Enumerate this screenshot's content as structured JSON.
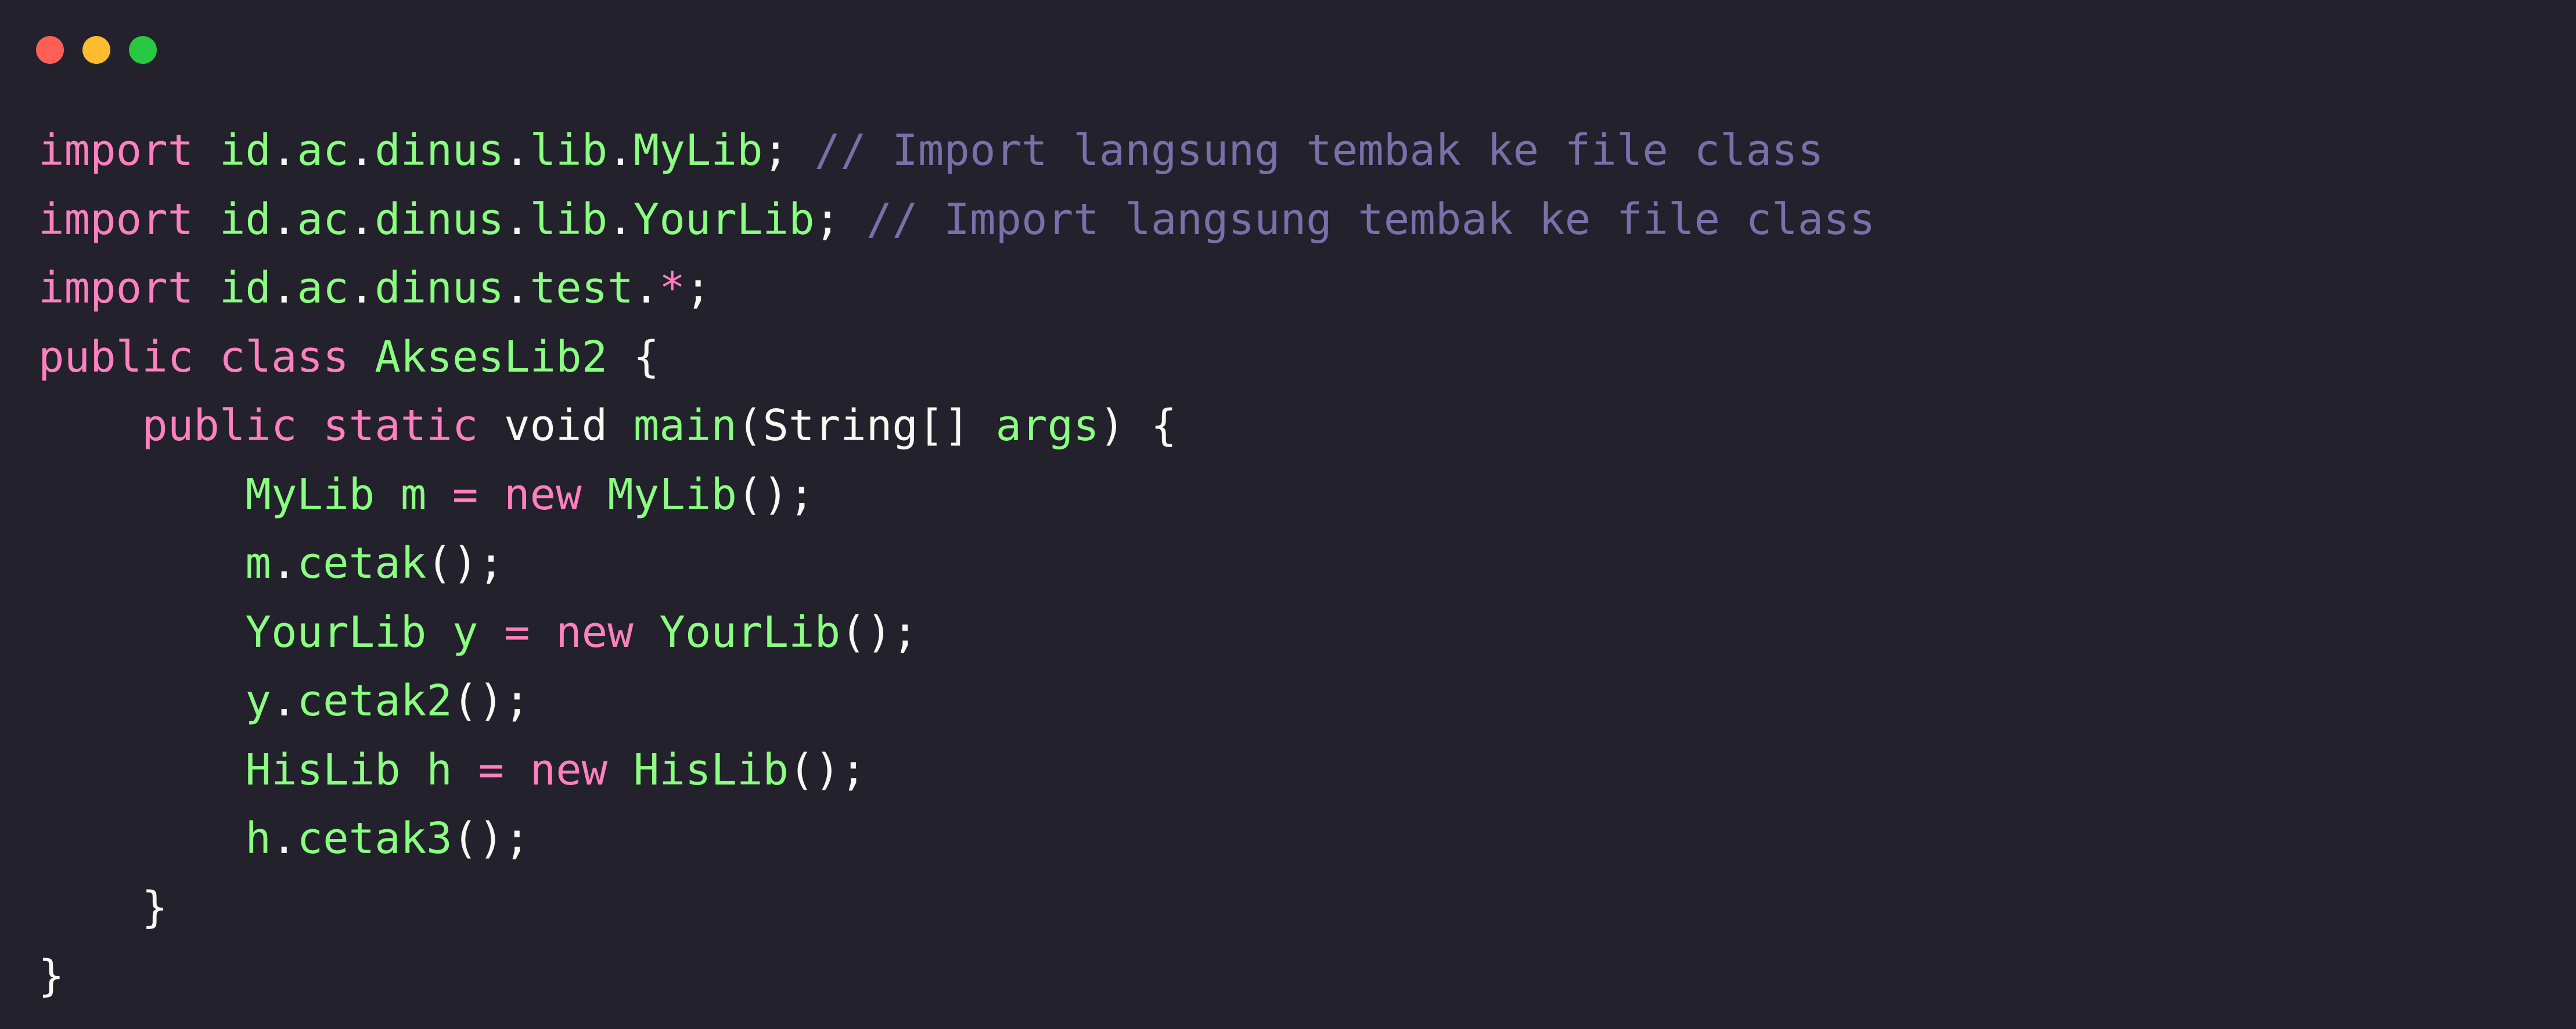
{
  "window": {
    "controls": [
      {
        "name": "close-button",
        "color": "#ff5f57"
      },
      {
        "name": "minimize-button",
        "color": "#febc2e"
      },
      {
        "name": "maximize-button",
        "color": "#28c840"
      }
    ]
  },
  "theme": {
    "background": "#22212c",
    "keyword": "#ff80bf",
    "identifier": "#8aff80",
    "comment": "#7970a9",
    "plain": "#f8f8f2"
  },
  "code": {
    "lines": [
      [
        {
          "t": "import",
          "k": "keyword"
        },
        {
          "t": " ",
          "k": "plain"
        },
        {
          "t": "id",
          "k": "ident"
        },
        {
          "t": ".",
          "k": "plain"
        },
        {
          "t": "ac",
          "k": "ident"
        },
        {
          "t": ".",
          "k": "plain"
        },
        {
          "t": "dinus",
          "k": "ident"
        },
        {
          "t": ".",
          "k": "plain"
        },
        {
          "t": "lib",
          "k": "ident"
        },
        {
          "t": ".",
          "k": "plain"
        },
        {
          "t": "MyLib",
          "k": "ident"
        },
        {
          "t": "; ",
          "k": "plain"
        },
        {
          "t": "// Import langsung tembak ke file class",
          "k": "comment"
        }
      ],
      [
        {
          "t": "import",
          "k": "keyword"
        },
        {
          "t": " ",
          "k": "plain"
        },
        {
          "t": "id",
          "k": "ident"
        },
        {
          "t": ".",
          "k": "plain"
        },
        {
          "t": "ac",
          "k": "ident"
        },
        {
          "t": ".",
          "k": "plain"
        },
        {
          "t": "dinus",
          "k": "ident"
        },
        {
          "t": ".",
          "k": "plain"
        },
        {
          "t": "lib",
          "k": "ident"
        },
        {
          "t": ".",
          "k": "plain"
        },
        {
          "t": "YourLib",
          "k": "ident"
        },
        {
          "t": "; ",
          "k": "plain"
        },
        {
          "t": "// Import langsung tembak ke file class",
          "k": "comment"
        }
      ],
      [
        {
          "t": "import",
          "k": "keyword"
        },
        {
          "t": " ",
          "k": "plain"
        },
        {
          "t": "id",
          "k": "ident"
        },
        {
          "t": ".",
          "k": "plain"
        },
        {
          "t": "ac",
          "k": "ident"
        },
        {
          "t": ".",
          "k": "plain"
        },
        {
          "t": "dinus",
          "k": "ident"
        },
        {
          "t": ".",
          "k": "plain"
        },
        {
          "t": "test",
          "k": "ident"
        },
        {
          "t": ".",
          "k": "plain"
        },
        {
          "t": "*",
          "k": "operator"
        },
        {
          "t": ";",
          "k": "plain"
        }
      ],
      [
        {
          "t": "public",
          "k": "keyword"
        },
        {
          "t": " ",
          "k": "plain"
        },
        {
          "t": "class",
          "k": "keyword"
        },
        {
          "t": " ",
          "k": "plain"
        },
        {
          "t": "AksesLib2",
          "k": "ident"
        },
        {
          "t": " {",
          "k": "plain"
        }
      ],
      [
        {
          "t": "    ",
          "k": "plain"
        },
        {
          "t": "public",
          "k": "keyword"
        },
        {
          "t": " ",
          "k": "plain"
        },
        {
          "t": "static",
          "k": "keyword"
        },
        {
          "t": " void ",
          "k": "plain"
        },
        {
          "t": "main",
          "k": "ident"
        },
        {
          "t": "(String[] ",
          "k": "plain"
        },
        {
          "t": "args",
          "k": "ident"
        },
        {
          "t": ") {",
          "k": "plain"
        }
      ],
      [
        {
          "t": "        ",
          "k": "plain"
        },
        {
          "t": "MyLib",
          "k": "ident"
        },
        {
          "t": " ",
          "k": "plain"
        },
        {
          "t": "m",
          "k": "ident"
        },
        {
          "t": " ",
          "k": "plain"
        },
        {
          "t": "=",
          "k": "operator"
        },
        {
          "t": " ",
          "k": "plain"
        },
        {
          "t": "new",
          "k": "keyword"
        },
        {
          "t": " ",
          "k": "plain"
        },
        {
          "t": "MyLib",
          "k": "ident"
        },
        {
          "t": "();",
          "k": "plain"
        }
      ],
      [
        {
          "t": "        ",
          "k": "plain"
        },
        {
          "t": "m",
          "k": "ident"
        },
        {
          "t": ".",
          "k": "plain"
        },
        {
          "t": "cetak",
          "k": "ident"
        },
        {
          "t": "();",
          "k": "plain"
        }
      ],
      [
        {
          "t": "        ",
          "k": "plain"
        },
        {
          "t": "YourLib",
          "k": "ident"
        },
        {
          "t": " ",
          "k": "plain"
        },
        {
          "t": "y",
          "k": "ident"
        },
        {
          "t": " ",
          "k": "plain"
        },
        {
          "t": "=",
          "k": "operator"
        },
        {
          "t": " ",
          "k": "plain"
        },
        {
          "t": "new",
          "k": "keyword"
        },
        {
          "t": " ",
          "k": "plain"
        },
        {
          "t": "YourLib",
          "k": "ident"
        },
        {
          "t": "();",
          "k": "plain"
        }
      ],
      [
        {
          "t": "        ",
          "k": "plain"
        },
        {
          "t": "y",
          "k": "ident"
        },
        {
          "t": ".",
          "k": "plain"
        },
        {
          "t": "cetak2",
          "k": "ident"
        },
        {
          "t": "();",
          "k": "plain"
        }
      ],
      [
        {
          "t": "        ",
          "k": "plain"
        },
        {
          "t": "HisLib",
          "k": "ident"
        },
        {
          "t": " ",
          "k": "plain"
        },
        {
          "t": "h",
          "k": "ident"
        },
        {
          "t": " ",
          "k": "plain"
        },
        {
          "t": "=",
          "k": "operator"
        },
        {
          "t": " ",
          "k": "plain"
        },
        {
          "t": "new",
          "k": "keyword"
        },
        {
          "t": " ",
          "k": "plain"
        },
        {
          "t": "HisLib",
          "k": "ident"
        },
        {
          "t": "();",
          "k": "plain"
        }
      ],
      [
        {
          "t": "        ",
          "k": "plain"
        },
        {
          "t": "h",
          "k": "ident"
        },
        {
          "t": ".",
          "k": "plain"
        },
        {
          "t": "cetak3",
          "k": "ident"
        },
        {
          "t": "();",
          "k": "plain"
        }
      ],
      [
        {
          "t": "    }",
          "k": "plain"
        }
      ],
      [
        {
          "t": "}",
          "k": "plain"
        }
      ]
    ]
  }
}
